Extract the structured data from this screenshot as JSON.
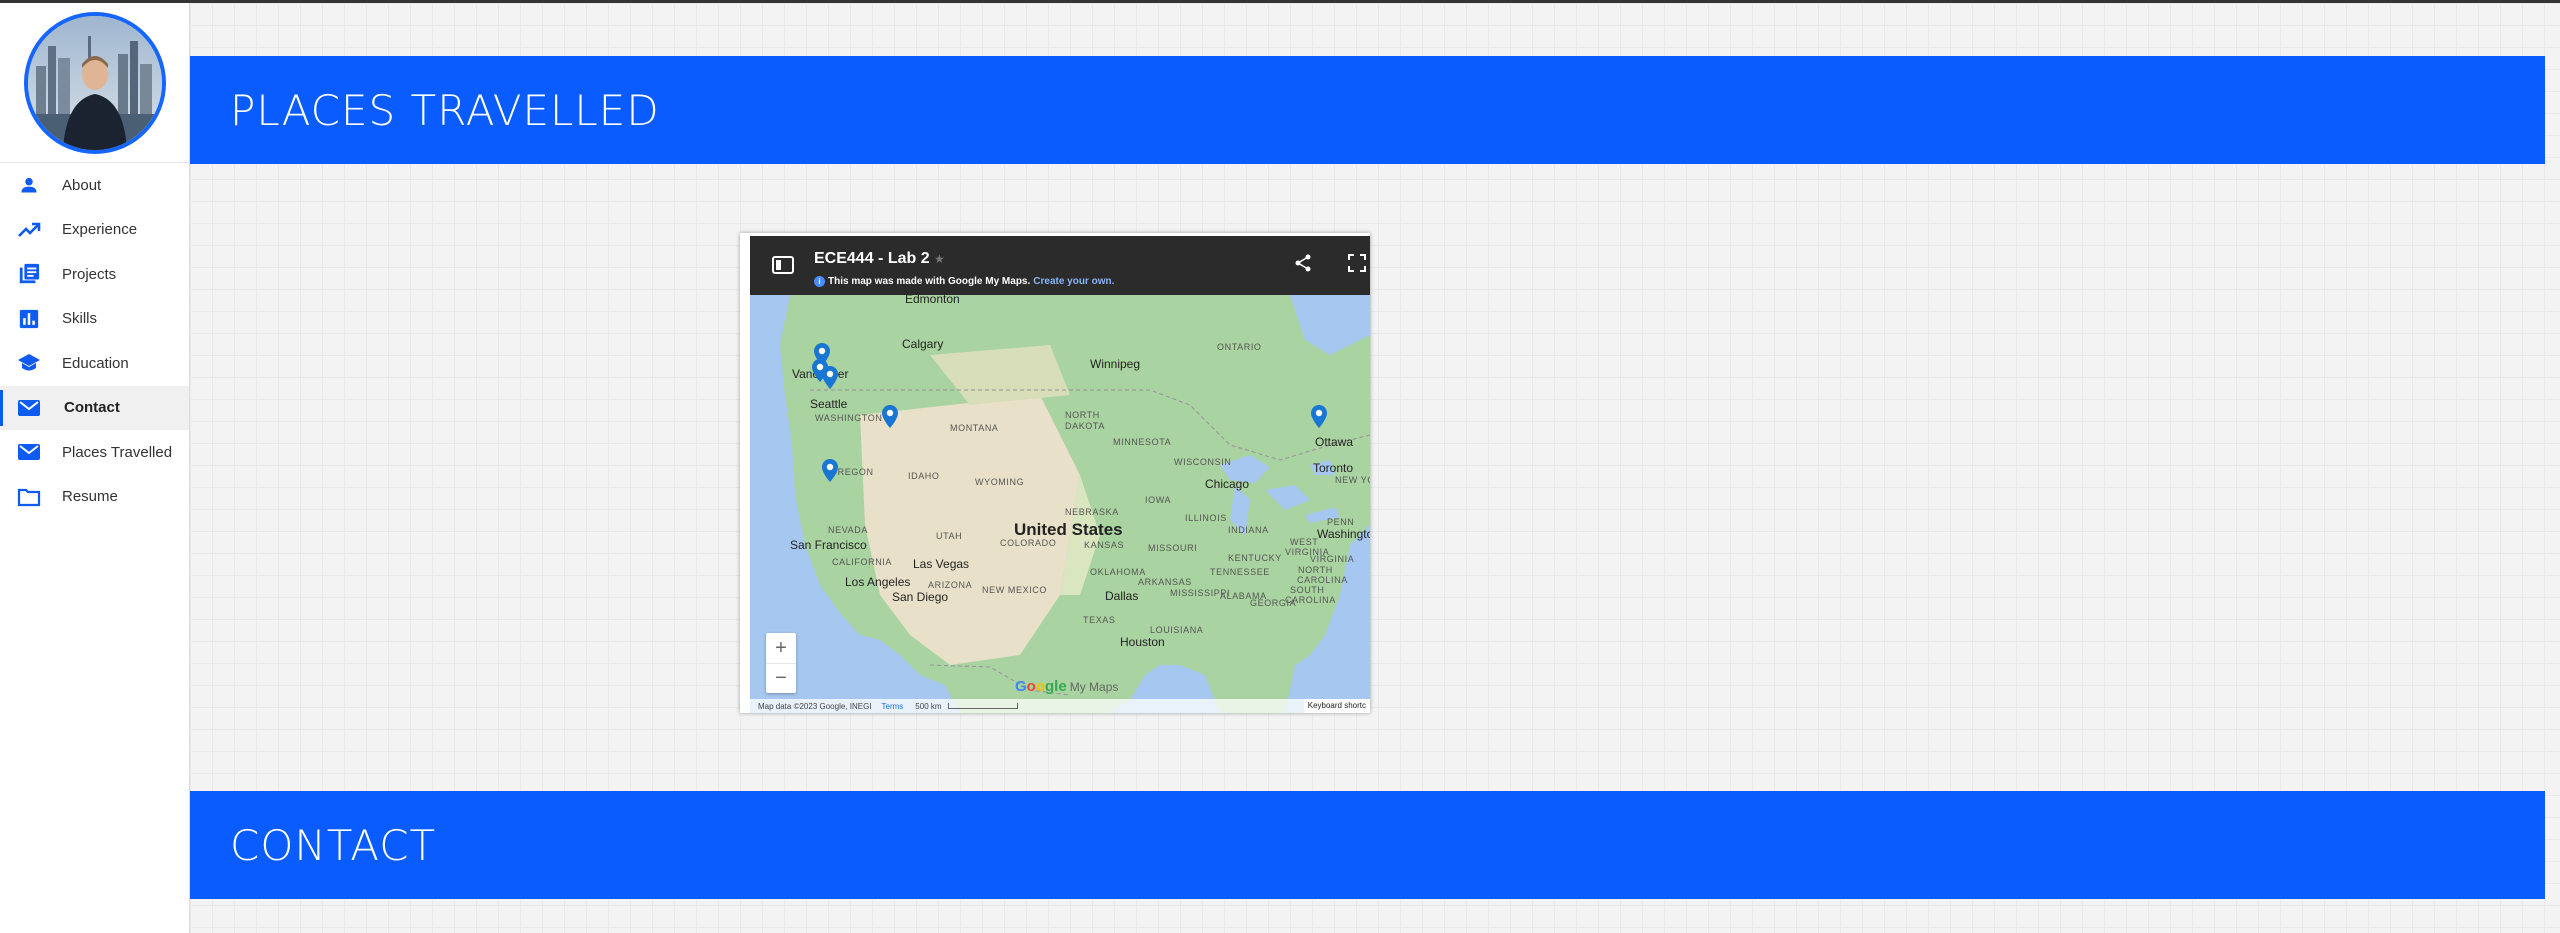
{
  "sidebar": {
    "items": [
      {
        "label": "About",
        "icon": "person-icon"
      },
      {
        "label": "Experience",
        "icon": "trending-up-icon"
      },
      {
        "label": "Projects",
        "icon": "document-list-icon"
      },
      {
        "label": "Skills",
        "icon": "bar-chart-icon"
      },
      {
        "label": "Education",
        "icon": "graduation-cap-icon"
      },
      {
        "label": "Contact",
        "icon": "mail-icon",
        "active": true
      },
      {
        "label": "Places Travelled",
        "icon": "mail-icon"
      },
      {
        "label": "Resume",
        "icon": "folder-icon"
      }
    ],
    "accent_color": "#0d5bf0"
  },
  "sections": {
    "places_title": "PLACES TRAVELLED",
    "contact_title": "CONTACT",
    "banner_color": "#0a5cff"
  },
  "map": {
    "title": "ECE444 - Lab 2",
    "made_with": "This map was made with Google My Maps.",
    "create_link": "Create your own.",
    "zoom_in": "+",
    "zoom_out": "−",
    "labels": {
      "edmonton": "Edmonton",
      "calgary": "Calgary",
      "winnipeg": "Winnipeg",
      "ontario": "ONTARIO",
      "vancouver": "Vancouver",
      "seattle": "Seattle",
      "washington": "WASHINGTON",
      "montana": "MONTANA",
      "north_dakota_1": "NORTH",
      "north_dakota_2": "DAKOTA",
      "minnesota": "MINNESOTA",
      "ottawa": "Ottawa",
      "toronto": "Toronto",
      "new_york": "NEW YORK",
      "oregon": "OREGON",
      "idaho": "IDAHO",
      "wyoming": "WYOMING",
      "wisconsin": "WISCONSIN",
      "chicago": "Chicago",
      "nebraska": "NEBRASKA",
      "iowa": "IOWA",
      "nevada": "NEVADA",
      "utah": "UTAH",
      "united_states": "United States",
      "illinois": "ILLINOIS",
      "indiana": "INDIANA",
      "penn": "PENN",
      "washington_dc": "Washingto",
      "san_francisco": "San Francisco",
      "colorado": "COLORADO",
      "kansas": "KANSAS",
      "missouri": "MISSOURI",
      "west_1": "WEST",
      "west_2": "VIRGINIA",
      "virginia": "VIRGINIA",
      "kentucky": "KENTUCKY",
      "california": "CALIFORNIA",
      "las_vegas": "Las Vegas",
      "oklahoma": "OKLAHOMA",
      "tennessee": "TENNESSEE",
      "north_carolina_1": "NORTH",
      "north_carolina_2": "CAROLINA",
      "los_angeles": "Los Angeles",
      "arizona": "ARIZONA",
      "new_mexico": "NEW MEXICO",
      "arkansas": "ARKANSAS",
      "south_carolina_1": "SOUTH",
      "south_carolina_2": "CAROLINA",
      "san_diego": "San Diego",
      "dallas": "Dallas",
      "mississippi": "MISSISSIPPI",
      "alabama": "ALABAMA",
      "georgia": "GEORGIA",
      "texas": "TEXAS",
      "louisiana": "LOUISIANA",
      "houston": "Houston"
    },
    "footer": {
      "data": "Map data ©2023 Google, INEGI",
      "terms": "Terms",
      "scale": "500 km",
      "keyboard": "Keyboard shortc"
    },
    "logo": {
      "g1": "G",
      "g2": "o",
      "g3": "o",
      "g4": "gle",
      "mymaps": "My Maps"
    },
    "pin_color": "#1976d2"
  }
}
